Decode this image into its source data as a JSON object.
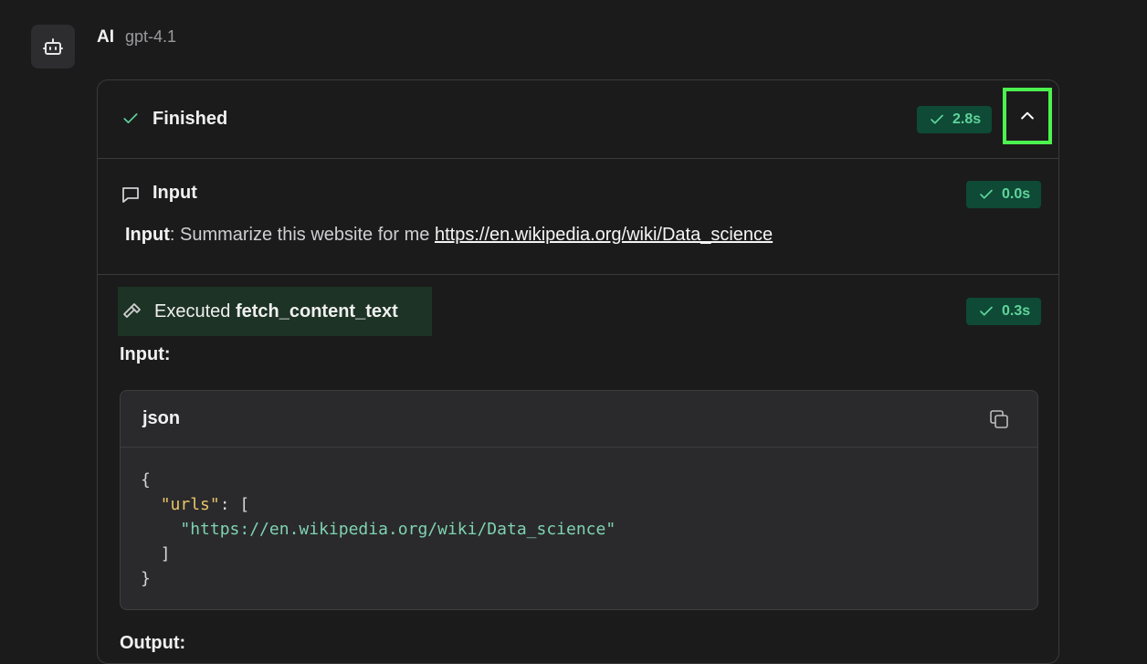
{
  "message": {
    "sender": "AI",
    "model": "gpt-4.1"
  },
  "status": {
    "title": "Finished",
    "duration": "2.8s"
  },
  "input_step": {
    "title": "Input",
    "duration": "0.0s",
    "label": "Input",
    "separator": ":",
    "text": " Summarize this website for me ",
    "link": "https://en.wikipedia.org/wiki/Data_science"
  },
  "tool_step": {
    "prefix": "Executed",
    "tool_name": "fetch_content_text",
    "duration": "0.3s",
    "input_label": "Input:",
    "output_label": "Output:",
    "code": {
      "language": "json",
      "open_brace": "{",
      "key": "\"urls\"",
      "colon_bracket": ": [",
      "url": "\"https://en.wikipedia.org/wiki/Data_science\"",
      "close_bracket": "]",
      "close_brace": "}"
    }
  },
  "colors": {
    "background": "#1b1b1c",
    "badge_bg": "#0e4a36",
    "badge_text": "#5fd49a",
    "focus_outline": "#4cf24e",
    "tool_highlight": "#1d3325"
  },
  "icons": [
    "bot-icon",
    "check-icon",
    "chevron-up-icon",
    "chat-bubble-icon",
    "hammer-icon",
    "copy-icon"
  ]
}
